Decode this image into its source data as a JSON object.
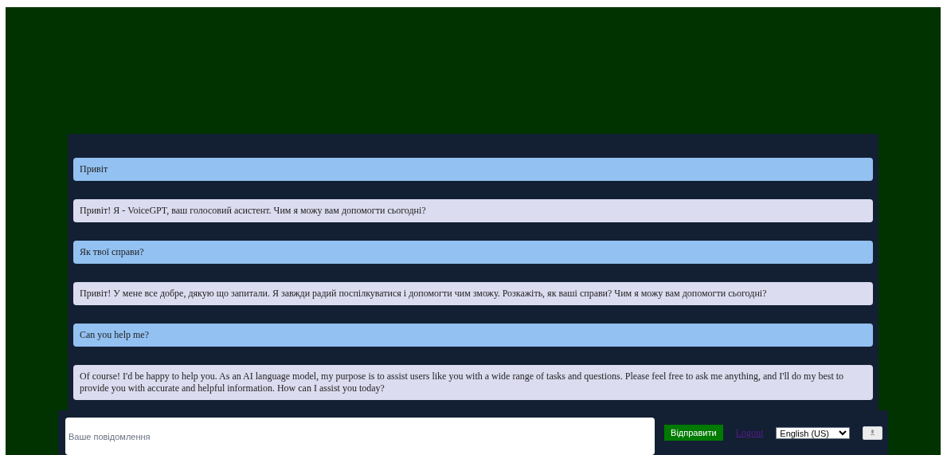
{
  "messages": [
    {
      "kind": "user",
      "text": "Привіт"
    },
    {
      "kind": "assistant",
      "text": "Привіт! Я - VoiceGPT, ваш голосовий асистент. Чим я можу вам допомогти сьогодні?"
    },
    {
      "kind": "user",
      "text": "Як твої справи?"
    },
    {
      "kind": "assistant",
      "text": "Привіт! У мене все добре, дякую що запитали. Я завжди радий поспілкуватися і допомогти чим зможу. Розкажіть, як ваші справи? Чим я можу вам допомогти сьогодні?"
    },
    {
      "kind": "user",
      "text": "Can you help me?"
    },
    {
      "kind": "assistant",
      "text": "Of course! I'd be happy to help you. As an AI language model, my purpose is to assist users like you with a wide range of tasks and questions. Please feel free to ask me anything, and I'll do my best to provide you with accurate and helpful information. How can I assist you today?"
    }
  ],
  "composer": {
    "placeholder": "Ваше повідомлення",
    "send_button": "Відправити",
    "logout_link": "Logout",
    "language": "English (US)"
  }
}
